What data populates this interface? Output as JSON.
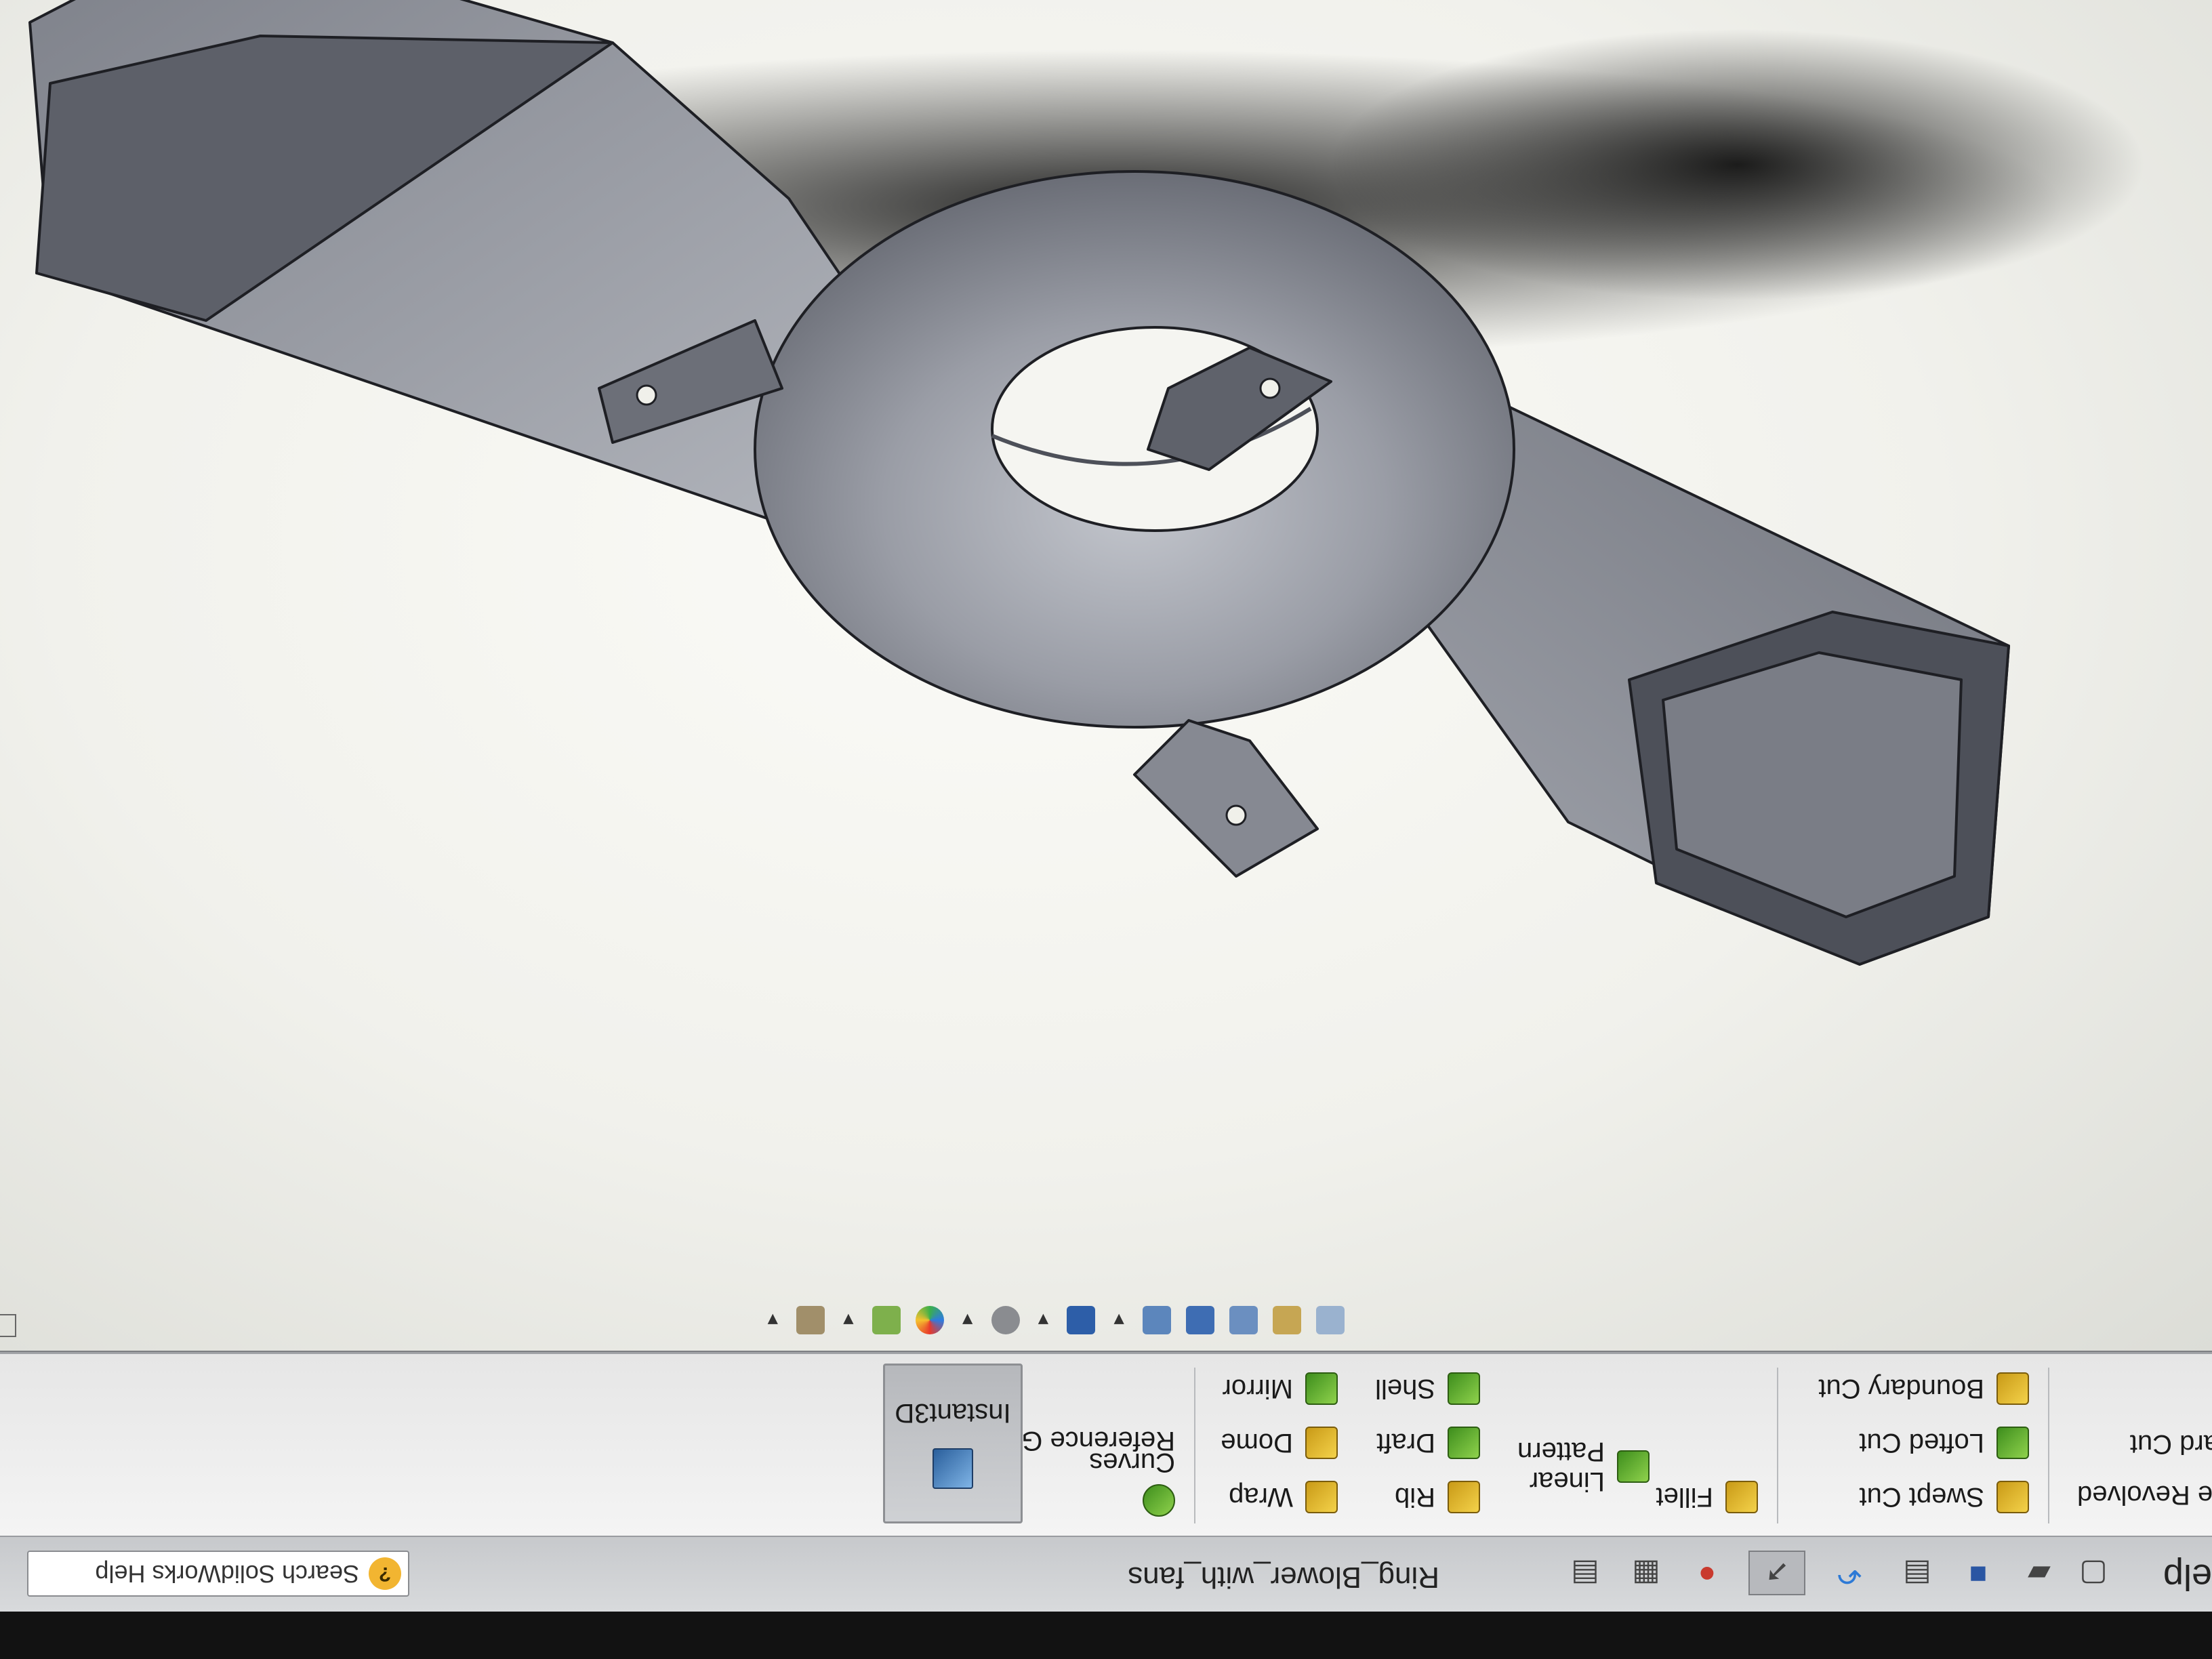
{
  "window": {
    "menu_partial": "elp",
    "document_title": "Ring_Blower_with_fans",
    "search_placeholder": "Search SolidWorks Help"
  },
  "command_manager": {
    "col1": [
      "Swept Cut",
      "Lofted Cut",
      "Boundary Cut"
    ],
    "col0_partial": [
      "le Revolved",
      "ard Cut"
    ],
    "col2": [
      "Fillet",
      "Linear Pattern"
    ],
    "col3": [
      "Rib",
      "Draft",
      "Shell"
    ],
    "col4": [
      "Wrap",
      "Dome",
      "Mirror"
    ],
    "ref_geometry": "Reference Geometry",
    "curves": "Curves",
    "instant3d": "Instant3D"
  },
  "icons": [
    "help-icon",
    "new-document-icon",
    "open-icon",
    "save-icon",
    "print-icon",
    "undo-icon",
    "select-icon",
    "rebuild-icon",
    "file-properties-icon",
    "options-icon",
    "view-orientation-icon",
    "section-view-icon",
    "display-style-icon",
    "appearance-icon",
    "scene-icon",
    "zoom-icon"
  ],
  "colors": {
    "model_face": "#9a9da6",
    "model_dark": "#5a5d66",
    "edge": "#1e1f24",
    "toolbar": "#ececec"
  }
}
